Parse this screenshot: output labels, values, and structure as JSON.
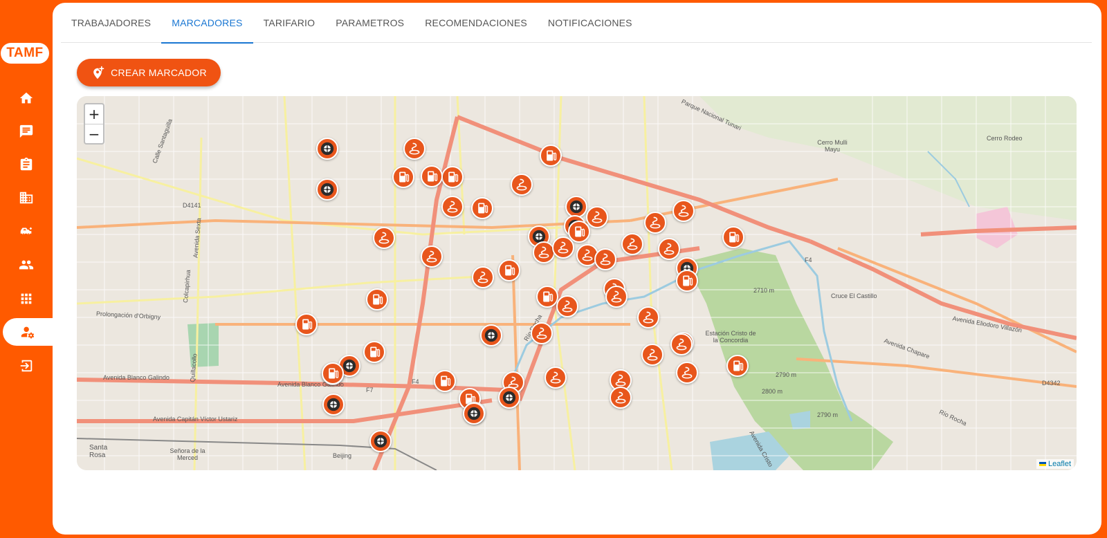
{
  "app": {
    "logo": "TAMF"
  },
  "sidebar": {
    "items": [
      {
        "name": "home-icon"
      },
      {
        "name": "chat-icon"
      },
      {
        "name": "clipboard-icon"
      },
      {
        "name": "building-icon"
      },
      {
        "name": "vehicle-icon"
      },
      {
        "name": "people-icon"
      },
      {
        "name": "apps-icon"
      },
      {
        "name": "user-settings-icon",
        "active": true
      },
      {
        "name": "logout-icon"
      }
    ]
  },
  "tabs": [
    {
      "label": "TRABAJADORES"
    },
    {
      "label": "MARCADORES",
      "active": true
    },
    {
      "label": "TARIFARIO"
    },
    {
      "label": "PARAMETROS"
    },
    {
      "label": "RECOMENDACIONES"
    },
    {
      "label": "NOTIFICACIONES"
    }
  ],
  "create_button": {
    "label": "CREAR MARCADOR"
  },
  "map": {
    "zoom_in": "+",
    "zoom_out": "−",
    "attribution": "Leaflet",
    "labels": [
      "Parque Nacional Tunari",
      "Cerro Mulli Mayu",
      "Cerro Rodeo",
      "D4141",
      "Calle Santaguilla",
      "Avenida Sexta",
      "Colcapirhua",
      "Prolongación d'Orbigny",
      "Avenida Blanco Galindo",
      "Avenida Capitán Víctor Ustariz",
      "Santa Rosa",
      "Señora de la Merced",
      "Beijing",
      "F4",
      "F7",
      "Río Rocha",
      "2710 m",
      "Cruce El Castillo",
      "Avenida Eliodoro Villazón",
      "Avenida Chapare",
      "D4342",
      "Estación Cristo de la Concordia",
      "2790 m",
      "2800 m",
      "Avenida Cristo",
      "Quillacollo"
    ],
    "markers": [
      {
        "type": "tire"
      },
      {
        "type": "tire"
      },
      {
        "type": "fuel"
      },
      {
        "type": "fuel"
      },
      {
        "type": "fuel"
      },
      {
        "type": "wash"
      },
      {
        "type": "fuel"
      },
      {
        "type": "wash"
      },
      {
        "type": "fuel"
      },
      {
        "type": "wash"
      },
      {
        "type": "tire"
      },
      {
        "type": "wash"
      },
      {
        "type": "tire"
      },
      {
        "type": "fuel"
      },
      {
        "type": "wash"
      },
      {
        "type": "wash"
      },
      {
        "type": "wash"
      },
      {
        "type": "tire"
      },
      {
        "type": "wash"
      },
      {
        "type": "wash"
      },
      {
        "type": "wash"
      },
      {
        "type": "wash"
      },
      {
        "type": "wash"
      },
      {
        "type": "wash"
      },
      {
        "type": "fuel"
      },
      {
        "type": "fuel"
      },
      {
        "type": "wash"
      },
      {
        "type": "fuel"
      },
      {
        "type": "wash"
      },
      {
        "type": "tire"
      },
      {
        "type": "fuel"
      },
      {
        "type": "wash"
      },
      {
        "type": "wash"
      },
      {
        "type": "fuel"
      },
      {
        "type": "wash"
      },
      {
        "type": "wash"
      },
      {
        "type": "tire"
      },
      {
        "type": "wash"
      },
      {
        "type": "wash"
      },
      {
        "type": "fuel"
      },
      {
        "type": "fuel"
      },
      {
        "type": "tire"
      },
      {
        "type": "tire"
      },
      {
        "type": "fuel"
      },
      {
        "type": "wash"
      },
      {
        "type": "wash"
      },
      {
        "type": "fuel"
      },
      {
        "type": "tire"
      },
      {
        "type": "tire"
      },
      {
        "type": "wash"
      },
      {
        "type": "wash"
      },
      {
        "type": "wash"
      },
      {
        "type": "wash"
      },
      {
        "type": "wash"
      },
      {
        "type": "tire"
      },
      {
        "type": "fuel"
      },
      {
        "type": "tire"
      },
      {
        "type": "tire"
      },
      {
        "type": "fuel"
      }
    ]
  },
  "colors": {
    "brand": "#ff5a00",
    "marker": "#e8561c",
    "tab_active": "#1976d2"
  }
}
